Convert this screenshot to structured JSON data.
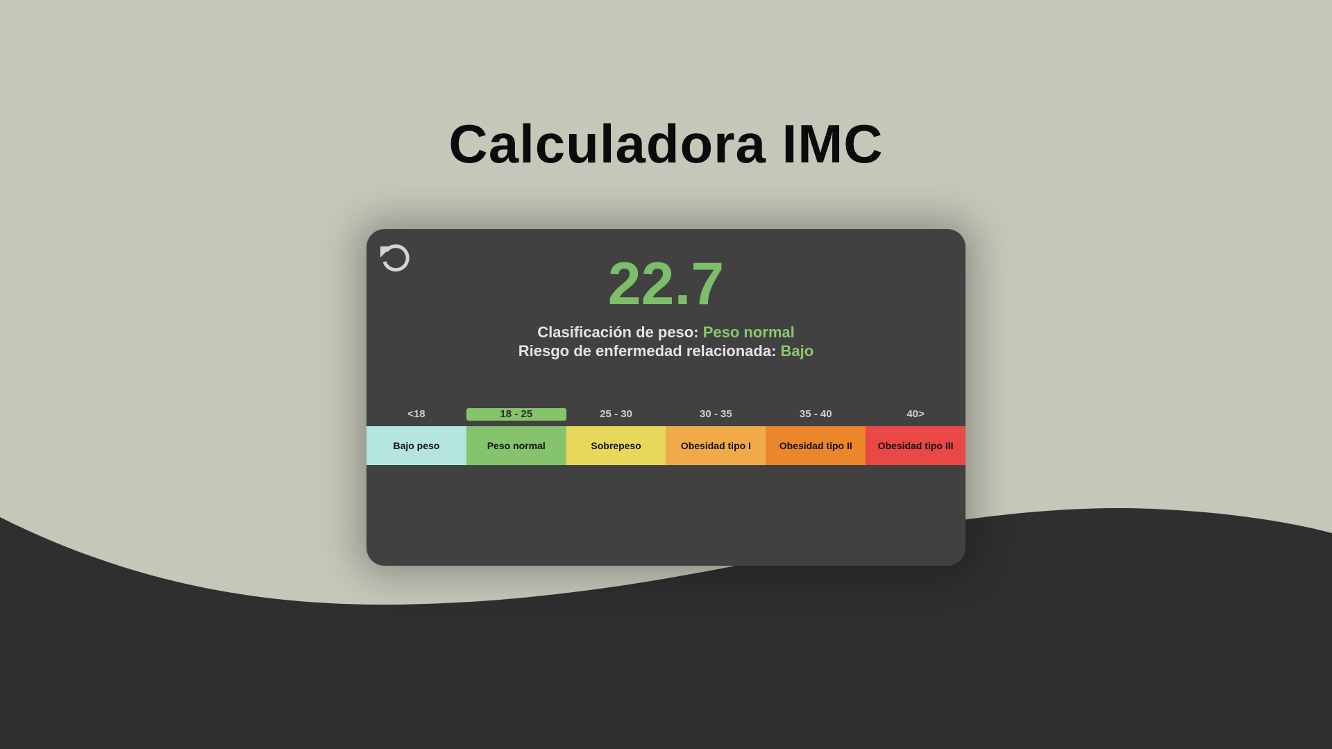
{
  "page": {
    "title": "Calculadora IMC"
  },
  "result": {
    "value": "22.7",
    "classification_label": "Clasificación de peso:",
    "classification_value": "Peso normal",
    "risk_label": "Riesgo de enfermedad relacionada:",
    "risk_value": "Bajo",
    "accent_color": "#7dbe6b"
  },
  "reset_icon": "reset-arrow-icon",
  "scale": [
    {
      "range": "<18",
      "label": "Bajo peso",
      "color": "#b4e6df",
      "active": false
    },
    {
      "range": "18 - 25",
      "label": "Peso normal",
      "color": "#85c46c",
      "active": true
    },
    {
      "range": "25 - 30",
      "label": "Sobrepeso",
      "color": "#e7d75a",
      "active": false
    },
    {
      "range": "30 - 35",
      "label": "Obesidad tipo I",
      "color": "#f0aa4a",
      "active": false
    },
    {
      "range": "35 - 40",
      "label": "Obesidad tipo II",
      "color": "#eb862a",
      "active": false
    },
    {
      "range": "40>",
      "label": "Obesidad tipo III",
      "color": "#ea4747",
      "active": false
    }
  ]
}
